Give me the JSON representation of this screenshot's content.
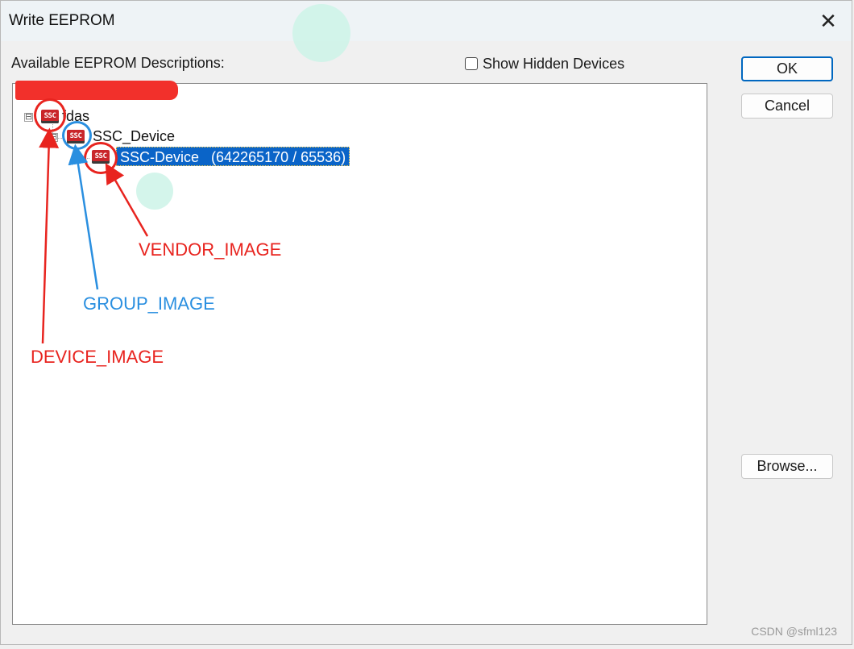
{
  "window": {
    "title": "Write EEPROM",
    "close_glyph": "✕"
  },
  "header": {
    "available_label": "Available EEPROM Descriptions:",
    "show_hidden_label": "Show Hidden Devices",
    "show_hidden_checked": false
  },
  "buttons": {
    "ok": "OK",
    "cancel": "Cancel",
    "browse": "Browse..."
  },
  "tree": {
    "nodes": [
      {
        "label": "fdas",
        "icon": "ssc-icon",
        "icon_text": "SSC",
        "expander": "⊟"
      },
      {
        "label": "SSC_Device",
        "icon": "ssc-icon",
        "icon_text": "SSC",
        "expander": "⊟"
      },
      {
        "label": "SSC-Device   (642265170 / 65536)",
        "icon": "ssc-icon",
        "icon_text": "SSC",
        "selected": true
      }
    ]
  },
  "annotations": {
    "vendor": "VENDOR_IMAGE",
    "group": "GROUP_IMAGE",
    "device": "DEVICE_IMAGE"
  },
  "watermark": "CSDN @sfml123",
  "colors": {
    "annotation_red": "#e8241f",
    "annotation_blue": "#2a8fe0",
    "selection": "#0a64c8",
    "icon_red": "#c9262a",
    "ok_border": "#0067c0"
  }
}
